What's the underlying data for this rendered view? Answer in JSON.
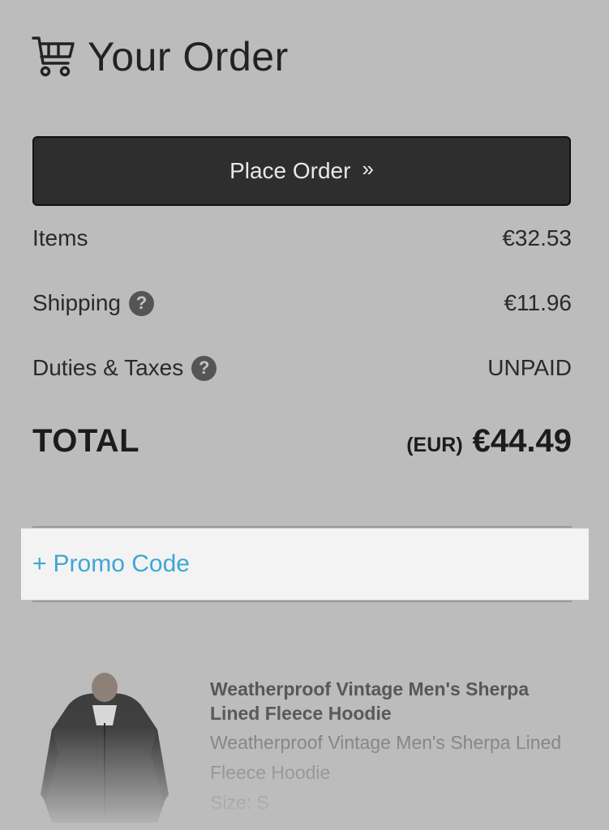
{
  "header": {
    "title": "Your Order",
    "icon": "cart-icon"
  },
  "place_order": {
    "label": "Place Order",
    "chevron": "»"
  },
  "summary": {
    "items": {
      "label": "Items",
      "value": "€32.53"
    },
    "shipping": {
      "label": "Shipping",
      "value": "€11.96",
      "help": "?"
    },
    "duties": {
      "label": "Duties & Taxes",
      "value": "UNPAID",
      "help": "?"
    }
  },
  "total": {
    "label": "TOTAL",
    "currency": "(EUR)",
    "amount": "€44.49"
  },
  "promo": {
    "plus": "+",
    "label": "Promo Code"
  },
  "product": {
    "title": "Weatherproof Vintage Men's Sherpa Lined Fleece Hoodie",
    "description": "Weatherproof Vintage Men's Sherpa Lined Fleece Hoodie",
    "size": "Size: S"
  },
  "colors": {
    "accent": "#3ea6d6",
    "button_bg": "#2e2e2e",
    "page_bg": "#bcbcbc"
  }
}
